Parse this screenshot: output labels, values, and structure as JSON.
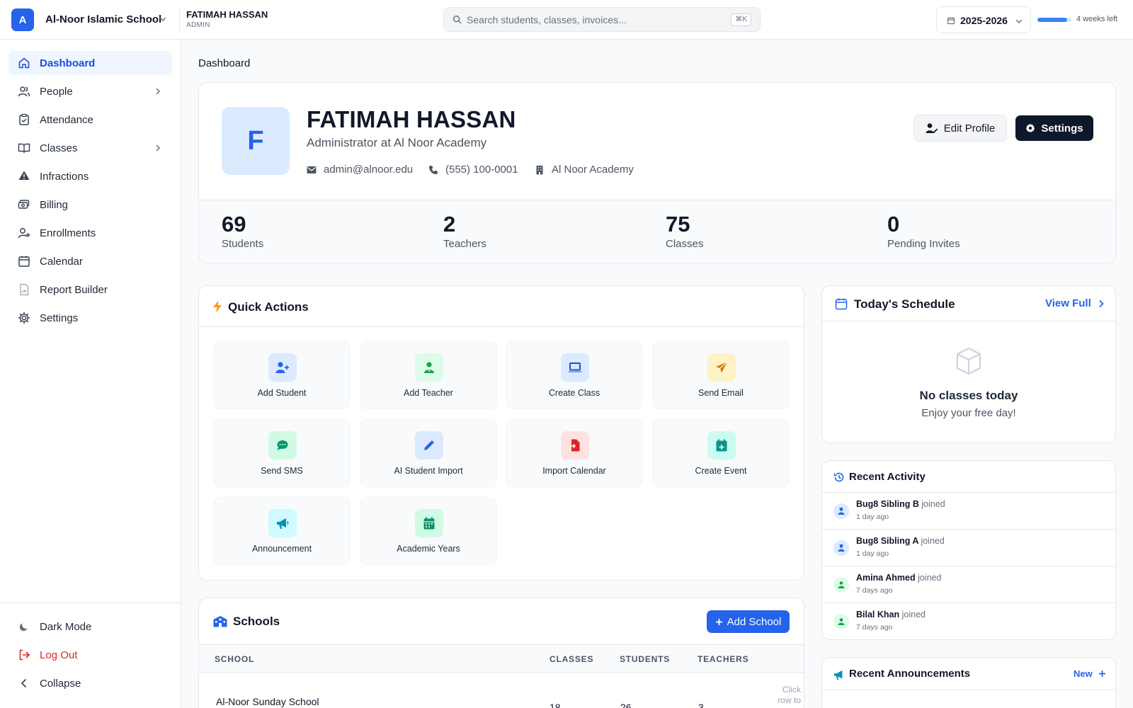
{
  "topbar": {
    "logo_letter": "A",
    "school_name": "Al-Noor Islamic School",
    "user_name": "FATIMAH HASSAN",
    "user_role": "ADMIN",
    "search_placeholder": "Search students, classes, invoices...",
    "shortcut": "⌘K",
    "academic_year": "2025-2026",
    "year_progress": 0.88,
    "weeks_left": "4 weeks left"
  },
  "sidebar": {
    "items": [
      {
        "label": "Dashboard",
        "icon": "home-icon",
        "active": true
      },
      {
        "label": "People",
        "icon": "users-icon",
        "has_children": true
      },
      {
        "label": "Attendance",
        "icon": "clipboard-check-icon"
      },
      {
        "label": "Classes",
        "icon": "book-open-icon",
        "has_children": true
      },
      {
        "label": "Infractions",
        "icon": "warning-icon"
      },
      {
        "label": "Billing",
        "icon": "billing-icon"
      },
      {
        "label": "Enrollments",
        "icon": "user-plus-icon"
      },
      {
        "label": "Calendar",
        "icon": "calendar-icon"
      },
      {
        "label": "Report Builder",
        "icon": "report-icon"
      },
      {
        "label": "Settings",
        "icon": "gear-icon"
      }
    ],
    "bottom": [
      {
        "label": "Dark Mode",
        "icon": "moon-icon"
      },
      {
        "label": "Log Out",
        "icon": "logout-icon"
      },
      {
        "label": "Collapse",
        "icon": "chevron-left-icon"
      }
    ]
  },
  "breadcrumb": "Dashboard",
  "profile": {
    "initial": "F",
    "name": "FATIMAH HASSAN",
    "subtitle": "Administrator at Al Noor Academy",
    "email": "admin@alnoor.edu",
    "phone": "(555) 100-0001",
    "organization": "Al Noor Academy",
    "edit_label": "Edit Profile",
    "settings_label": "Settings",
    "stats": [
      {
        "value": "69",
        "label": "Students"
      },
      {
        "value": "2",
        "label": "Teachers"
      },
      {
        "value": "75",
        "label": "Classes"
      },
      {
        "value": "0",
        "label": "Pending Invites"
      }
    ]
  },
  "quick_actions": {
    "title": "Quick Actions",
    "items": [
      {
        "label": "Add Student",
        "icon": "user-plus-icon",
        "color": "#2563eb",
        "bg": "#dbeafe"
      },
      {
        "label": "Add Teacher",
        "icon": "teacher-icon",
        "color": "#16a34a",
        "bg": "#dcfce7"
      },
      {
        "label": "Create Class",
        "icon": "laptop-icon",
        "color": "#1d4ed8",
        "bg": "#dbeafe"
      },
      {
        "label": "Send Email",
        "icon": "paper-plane-icon",
        "color": "#d97706",
        "bg": "#fef3c7"
      },
      {
        "label": "Send SMS",
        "icon": "sms-icon",
        "color": "#059669",
        "bg": "#d1fae5"
      },
      {
        "label": "AI Student Import",
        "icon": "pencil-icon",
        "color": "#2563eb",
        "bg": "#dbeafe"
      },
      {
        "label": "Import Calendar",
        "icon": "file-import-icon",
        "color": "#dc2626",
        "bg": "#fee2e2"
      },
      {
        "label": "Create Event",
        "icon": "calendar-plus-icon",
        "color": "#0d9488",
        "bg": "#ccfbf1"
      },
      {
        "label": "Announcement",
        "icon": "megaphone-icon",
        "color": "#0891b2",
        "bg": "#cffafe"
      },
      {
        "label": "Academic Years",
        "icon": "calendar-icon",
        "color": "#059669",
        "bg": "#d1fae5"
      }
    ]
  },
  "schools": {
    "title": "Schools",
    "add_label": "Add School",
    "columns": [
      "SCHOOL",
      "CLASSES",
      "STUDENTS",
      "TEACHERS"
    ],
    "rows": [
      {
        "school": "Al-Noor Sunday School",
        "classes": "18",
        "students": "26",
        "teachers": "3",
        "hint": "Click row to"
      }
    ]
  },
  "schedule": {
    "title": "Today's Schedule",
    "view_full": "View Full",
    "empty_title": "No classes today",
    "empty_sub": "Enjoy your free day!"
  },
  "activity": {
    "title": "Recent Activity",
    "items": [
      {
        "name": "Bug8 Sibling B",
        "verb": "joined",
        "time": "1 day ago",
        "kind": "student"
      },
      {
        "name": "Bug8 Sibling A",
        "verb": "joined",
        "time": "1 day ago",
        "kind": "student"
      },
      {
        "name": "Amina Ahmed",
        "verb": "joined",
        "time": "7 days ago",
        "kind": "teacher"
      },
      {
        "name": "Bilal Khan",
        "verb": "joined",
        "time": "7 days ago",
        "kind": "teacher"
      }
    ]
  },
  "announcements": {
    "title": "Recent Announcements",
    "new_label": "New"
  },
  "colors": {
    "accent": "#2563eb",
    "dark": "#0f172a",
    "danger": "#dc2626"
  }
}
